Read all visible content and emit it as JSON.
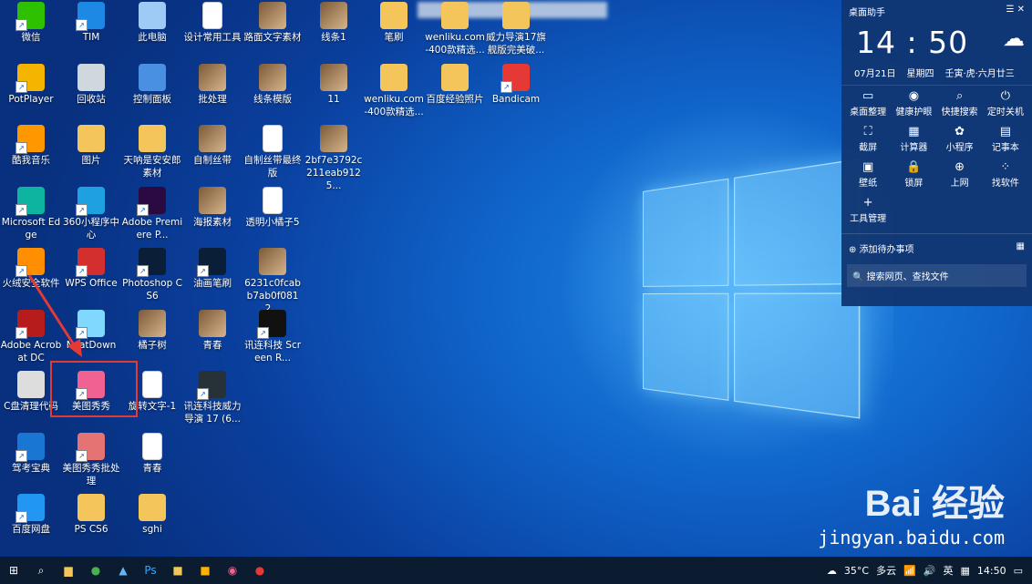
{
  "desktop_icons": [
    {
      "label": "微信",
      "icon": "wechat-icon",
      "color": "#2dc100"
    },
    {
      "label": "TIM",
      "icon": "tim-icon",
      "color": "#1e88e5"
    },
    {
      "label": "此电脑",
      "icon": "computer-icon",
      "color": "#9ecbf5"
    },
    {
      "label": "设计常用工具",
      "icon": "document-icon",
      "color": "#ffffff"
    },
    {
      "label": "路面文字素材",
      "icon": "image-icon",
      "color": "#6d4c2f"
    },
    {
      "label": "线条1",
      "icon": "image-icon",
      "color": "#e8e8e8"
    },
    {
      "label": "笔刷",
      "icon": "folder-icon",
      "color": "#f3c55a"
    },
    {
      "label": "wenliku.com-400款精选...",
      "icon": "archive-icon",
      "color": "#f3c55a"
    },
    {
      "label": "威力导演17旗舰版完美破...",
      "icon": "archive-icon",
      "color": "#333333"
    },
    {
      "label": "PotPlayer",
      "icon": "potplayer-icon",
      "color": "#f4b400"
    },
    {
      "label": "回收站",
      "icon": "recycle-bin-icon",
      "color": "#cfd8dc"
    },
    {
      "label": "控制面板",
      "icon": "control-panel-icon",
      "color": "#4a90e2"
    },
    {
      "label": "批处理",
      "icon": "image-icon",
      "color": "#e8c8b0"
    },
    {
      "label": "线条模版",
      "icon": "image-icon",
      "color": "#b07a5a"
    },
    {
      "label": "11",
      "icon": "image-icon",
      "color": "#f0f0f0"
    },
    {
      "label": "wenliku.com-400款精选...",
      "icon": "archive-icon",
      "color": "#f3c55a"
    },
    {
      "label": "百度经验照片",
      "icon": "archive-icon",
      "color": "#f3c55a"
    },
    {
      "label": "Bandicam",
      "icon": "bandicam-icon",
      "color": "#e53935"
    },
    {
      "label": "酷我音乐",
      "icon": "kuwo-icon",
      "color": "#ff9800"
    },
    {
      "label": "图片",
      "icon": "folder-icon",
      "color": "#f3c55a"
    },
    {
      "label": "天呐是安安郎素材",
      "icon": "folder-icon",
      "color": "#f3c55a"
    },
    {
      "label": "自制丝带",
      "icon": "image-icon",
      "color": "#d7b48a"
    },
    {
      "label": "自制丝带最终版",
      "icon": "document-icon",
      "color": "#ffffff"
    },
    {
      "label": "2bf7e3792c211eab9125...",
      "icon": "image-icon",
      "color": "#9ecbf5"
    },
    {
      "label": "Microsoft Edge",
      "icon": "edge-icon",
      "color": "#0fb4a0"
    },
    {
      "label": "360小程序中心",
      "icon": "360-icon",
      "color": "#1fa0e0"
    },
    {
      "label": "Adobe Premiere P...",
      "icon": "premiere-icon",
      "color": "#2a0a40"
    },
    {
      "label": "海报素材",
      "icon": "image-icon",
      "color": "#1b3a6b"
    },
    {
      "label": "透明小橘子5",
      "icon": "document-icon",
      "color": "#ffffff"
    },
    {
      "label": "火绒安全软件",
      "icon": "huorong-icon",
      "color": "#ff8f00"
    },
    {
      "label": "WPS Office",
      "icon": "wps-icon",
      "color": "#d32f2f"
    },
    {
      "label": "Photoshop CS6",
      "icon": "photoshop-icon",
      "color": "#0b1e38"
    },
    {
      "label": "油画笔刷",
      "icon": "photoshop-icon",
      "color": "#0b1e38"
    },
    {
      "label": "6231c0fcabb7ab0f0812...",
      "icon": "image-icon",
      "color": "#f0f0f0"
    },
    {
      "label": "Adobe Acrobat DC",
      "icon": "acrobat-icon",
      "color": "#b71c1c"
    },
    {
      "label": "NeatDown",
      "icon": "neatdown-icon",
      "color": "#80d8ff"
    },
    {
      "label": "橘子树",
      "icon": "image-icon",
      "color": "#3a5a2a"
    },
    {
      "label": "青春",
      "icon": "image-icon",
      "color": "#f0d0c0"
    },
    {
      "label": "讯连科技 Screen R...",
      "icon": "screen-recorder-icon",
      "color": "#111111"
    },
    {
      "label": "C盘清理代码",
      "icon": "batch-file-icon",
      "color": "#dddddd"
    },
    {
      "label": "美图秀秀",
      "icon": "meitu-icon",
      "color": "#f06292"
    },
    {
      "label": "旋转文字-1",
      "icon": "document-icon",
      "color": "#ffffff"
    },
    {
      "label": "讯连科技威力导演 17 (6...",
      "icon": "powerdirector-icon",
      "color": "#263238"
    },
    {
      "label": "驾考宝典",
      "icon": "jiakao-icon",
      "color": "#1976d2"
    },
    {
      "label": "美图秀秀批处理",
      "icon": "meitu-batch-icon",
      "color": "#e57373"
    },
    {
      "label": "青春",
      "icon": "document-icon",
      "color": "#ffffff"
    },
    {
      "label": "百度网盘",
      "icon": "baidu-netdisk-icon",
      "color": "#2196f3"
    },
    {
      "label": "PS CS6",
      "icon": "archive-icon",
      "color": "#f3c55a"
    },
    {
      "label": "sghi",
      "icon": "folder-icon",
      "color": "#f3c55a"
    }
  ],
  "panel": {
    "title": "桌面助手",
    "time": "14 : 50",
    "date": "07月21日",
    "weekday": "星期四",
    "lunar": "壬寅·虎·六月廿三",
    "tools": [
      "桌面整理",
      "健康护眼",
      "快捷搜索",
      "定时关机",
      "截屏",
      "计算器",
      "小程序",
      "记事本",
      "壁纸",
      "锁屏",
      "上网",
      "找软件",
      "工具管理"
    ],
    "todo": "添加待办事项",
    "search_placeholder": "搜索网页、查找文件"
  },
  "watermark": {
    "logo": "Bai 经验",
    "url": "jingyan.baidu.com"
  },
  "taskbar": {
    "temp": "35°C",
    "weather": "多云",
    "ime": "英",
    "clock": "14:50"
  },
  "colors": {
    "accent": "#e53935",
    "taskbar": "#0b1c30"
  }
}
